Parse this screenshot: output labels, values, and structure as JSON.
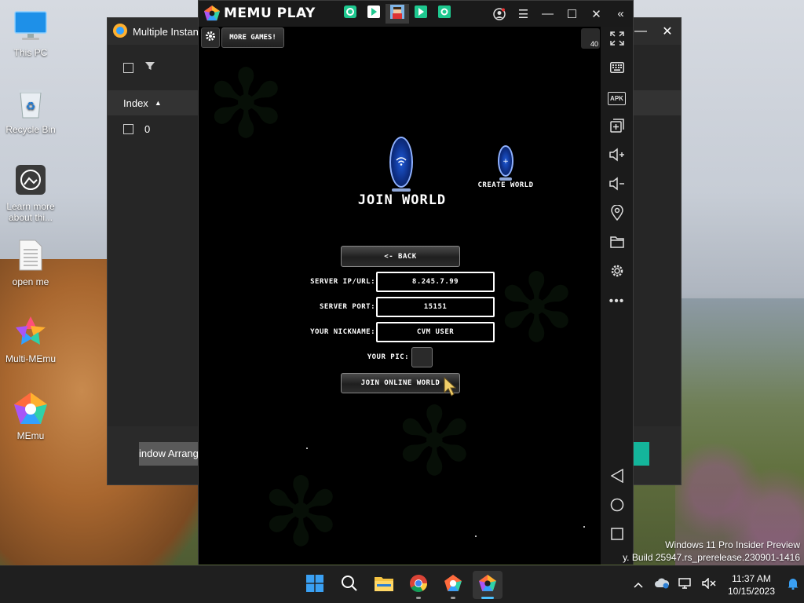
{
  "desktop": {
    "icons": [
      {
        "label": "This PC",
        "icon": "monitor-icon"
      },
      {
        "label": "Recycle Bin",
        "icon": "recycle-bin-icon"
      },
      {
        "label": "Learn more about thi...",
        "icon": "learn-more-icon"
      },
      {
        "label": "open me",
        "icon": "text-file-icon"
      },
      {
        "label": "Multi-MEmu",
        "icon": "multi-memu-icon"
      },
      {
        "label": "MEmu",
        "icon": "memu-icon"
      }
    ],
    "watermark": {
      "line1": "Windows 11 Pro Insider Preview",
      "line2": "y. Build 25947.rs_prerelease.230901-1416"
    }
  },
  "multi_memu": {
    "title": "Multiple Instanc",
    "column_index": "Index",
    "rows": [
      {
        "index": "0"
      }
    ],
    "arrange_button": "indow Arrange"
  },
  "memu": {
    "brand": "MEMU PLAY",
    "tabs": [
      "play-store-icon",
      "google-play-icon",
      "game-avatar-icon",
      "play-store-icon",
      "settings-app-icon"
    ],
    "sidebar_tools": [
      "fullscreen-icon",
      "keyboard-icon",
      "apk-icon",
      "add-icon",
      "volume-up-icon",
      "volume-down-icon",
      "location-icon",
      "folder-icon",
      "settings-icon",
      "more-icon",
      "back-icon",
      "home-icon",
      "recents-icon"
    ],
    "apk_label": "APK",
    "version_badge": "40"
  },
  "game": {
    "more_games": "MORE GAMES!",
    "join_world": "JOIN WORLD",
    "create_world": "CREATE WORLD",
    "back_button": "<- BACK",
    "fields": [
      {
        "label": "SERVER IP/URL:",
        "value": "8.245.7.99"
      },
      {
        "label": "SERVER PORT:",
        "value": "15151"
      },
      {
        "label": "YOUR NICKNAME:",
        "value": "CVM USER"
      }
    ],
    "pic_label": "YOUR PIC:",
    "join_online_button": "JOIN ONLINE WORLD"
  },
  "taskbar": {
    "apps": [
      "start-icon",
      "search-icon",
      "file-explorer-icon",
      "chrome-icon",
      "multi-memu-icon",
      "memu-icon"
    ],
    "time": "11:37 AM",
    "date": "10/15/2023"
  }
}
